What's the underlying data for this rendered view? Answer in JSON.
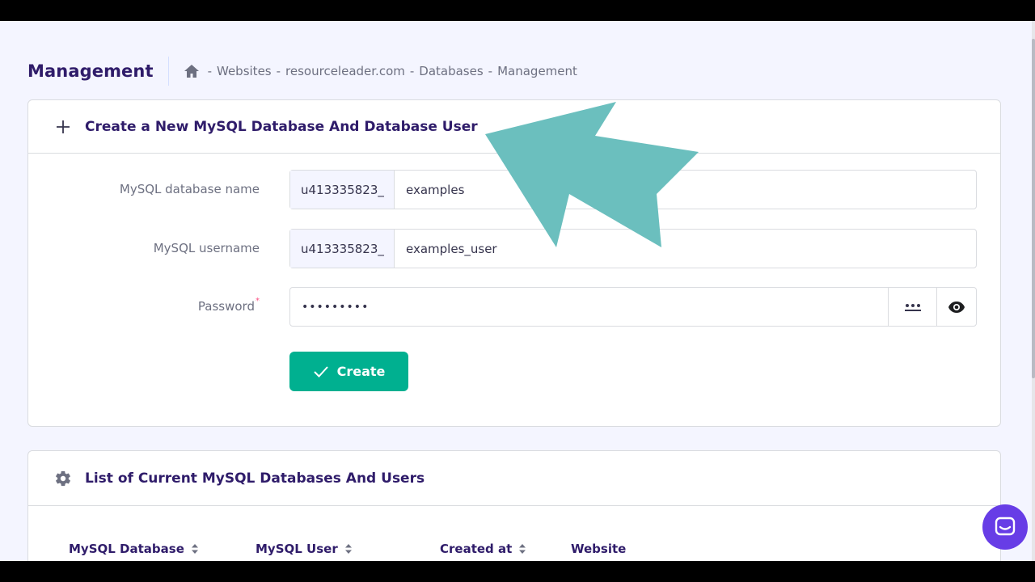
{
  "header": {
    "title": "Management",
    "breadcrumb": [
      "Websites",
      "resourceleader.com",
      "Databases",
      "Management"
    ],
    "separator": "-"
  },
  "create_card": {
    "title": "Create a New MySQL Database And Database User",
    "fields": {
      "db_name": {
        "label": "MySQL database name",
        "prefix": "u413335823_",
        "value": "examples"
      },
      "username": {
        "label": "MySQL username",
        "prefix": "u413335823_",
        "value": "examples_user"
      },
      "password": {
        "label": "Password",
        "required_mark": "*",
        "value": "•••••••••"
      }
    },
    "create_button": "Create"
  },
  "list_card": {
    "title": "List of Current MySQL Databases And Users",
    "columns": [
      "MySQL Database",
      "MySQL User",
      "Created at",
      "Website"
    ]
  },
  "colors": {
    "brand_purple": "#673de6",
    "title_color": "#2f1c6a",
    "create_green": "#00b090",
    "annotation_teal": "#6bbfbe"
  },
  "icons": {
    "home": "home-icon",
    "plus": "plus-icon",
    "gear": "gear-icon",
    "check": "check-icon",
    "generate_password": "dots-icon",
    "show_password": "eye-icon",
    "sort": "sort-icon",
    "chat": "chat-icon"
  }
}
